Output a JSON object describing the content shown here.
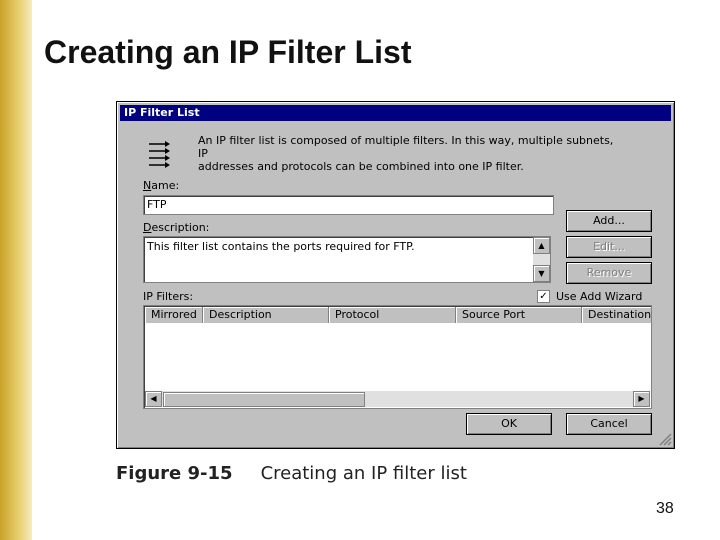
{
  "slide": {
    "title": "Creating an IP Filter List",
    "page_number": "38"
  },
  "dialog": {
    "title": "IP Filter List",
    "icon": "filter-list-icon",
    "intro_line1": "An IP filter list is composed of multiple filters. In this way, multiple subnets, IP",
    "intro_line2": "addresses and protocols can be combined into one IP filter.",
    "name_label_first": "N",
    "name_label_rest": "ame:",
    "name_value": "FTP",
    "description_label_first": "D",
    "description_label_rest": "escription:",
    "description_value": "This filter list contains the ports required for FTP.",
    "buttons": {
      "add": "Add...",
      "edit": "Edit...",
      "remove": "Remove",
      "ok": "OK",
      "cancel": "Cancel"
    },
    "use_wizard": {
      "label": "Use Add Wizard",
      "checked": true,
      "mark": "✓"
    },
    "filters_label": "IP Filters:",
    "columns": [
      "Mirrored",
      "Description",
      "Protocol",
      "Source Port",
      "Destination"
    ],
    "arrows": {
      "up": "▲",
      "down": "▼",
      "left": "◀",
      "right": "▶"
    }
  },
  "figure": {
    "number": "Figure 9-15",
    "caption": "Creating an IP filter list"
  }
}
